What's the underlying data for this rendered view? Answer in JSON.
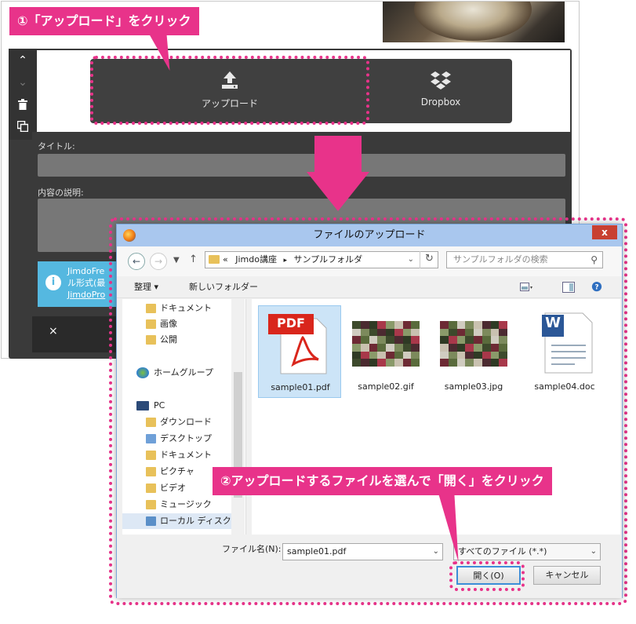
{
  "callouts": {
    "step1": "①「アップロード」をクリック",
    "step2": "②アップロードするファイルを選んで「開く」をクリック"
  },
  "editor": {
    "upload_label": "アップロード",
    "dropbox_label": "Dropbox",
    "title_label": "タイトル:",
    "description_label": "内容の説明:",
    "info_lines": [
      "JimdoFre",
      "ル形式(最",
      "JimdoPro"
    ],
    "close_symbol": "×"
  },
  "dialog": {
    "title": "ファイルのアップロード",
    "close_symbol": "x",
    "breadcrumb": {
      "root": "«",
      "parent": "Jimdo講座",
      "separator": "▸",
      "current": "サンプルフォルダ"
    },
    "search_placeholder": "サンプルフォルダの検索",
    "toolbar": {
      "organize": "整理 ▾",
      "new_folder": "新しいフォルダー"
    },
    "nav_items": [
      {
        "label": "ドキュメント"
      },
      {
        "label": "画像"
      },
      {
        "label": "公開"
      },
      {
        "label": "ホームグループ"
      },
      {
        "label": "PC"
      },
      {
        "label": "ダウンロード"
      },
      {
        "label": "デスクトップ"
      },
      {
        "label": "ドキュメント"
      },
      {
        "label": "ピクチャ"
      },
      {
        "label": "ビデオ"
      },
      {
        "label": "ミュージック"
      },
      {
        "label": "ローカル ディスク (C"
      }
    ],
    "files": [
      {
        "name": "sample01.pdf",
        "type": "pdf",
        "badge": "PDF"
      },
      {
        "name": "sample02.gif",
        "type": "image"
      },
      {
        "name": "sample03.jpg",
        "type": "image"
      },
      {
        "name": "sample04.doc",
        "type": "doc",
        "badge": "W"
      }
    ],
    "filename_label": "ファイル名(N):",
    "filename_value": "sample01.pdf",
    "filetype_value": "すべてのファイル (*.*)",
    "open_label": "開く(O)",
    "cancel_label": "キャンセル"
  },
  "colors": {
    "accent_pink": "#e8338a",
    "info_blue": "#55b8e0",
    "pdf_red": "#d9261c",
    "word_blue": "#2b5797"
  }
}
